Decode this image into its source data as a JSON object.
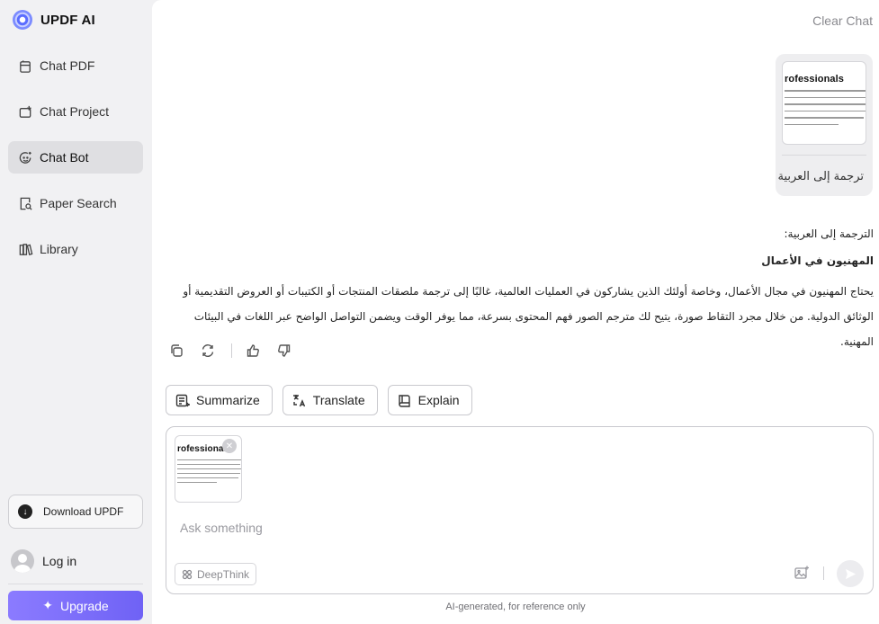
{
  "brand": {
    "name": "UPDF AI"
  },
  "sidebar": {
    "items": [
      {
        "label": "Chat PDF",
        "icon": "chat-pdf-icon",
        "active": false
      },
      {
        "label": "Chat Project",
        "icon": "chat-project-icon",
        "active": false
      },
      {
        "label": "Chat Bot",
        "icon": "chat-bot-icon",
        "active": true
      },
      {
        "label": "Paper Search",
        "icon": "paper-search-icon",
        "active": false
      },
      {
        "label": "Library",
        "icon": "library-icon",
        "active": false
      }
    ],
    "download_label": "Download UPDF",
    "login_label": "Log in",
    "upgrade_label": "Upgrade"
  },
  "header": {
    "clear_chat": "Clear Chat"
  },
  "user_message": {
    "attachment_title": "rofessionals",
    "text": "ترجمة إلى العربية"
  },
  "answer": {
    "intro": "الترجمة إلى العربية:",
    "heading": "المهنيون في الأعمال",
    "body": "يحتاج المهنيون في مجال الأعمال، وخاصة أولئك الذين يشاركون في العمليات العالمية، غالبًا إلى ترجمة ملصقات المنتجات أو الكتيبات أو العروض التقديمية أو الوثائق الدولية. من خلال مجرد التقاط صورة، يتيح لك مترجم الصور فهم المحتوى بسرعة، مما يوفر الوقت ويضمن التواصل الواضح عبر اللغات في البيئات المهنية."
  },
  "quick_actions": {
    "summarize": "Summarize",
    "translate": "Translate",
    "explain": "Explain"
  },
  "composer": {
    "attachment_title": "rofessionals",
    "placeholder": "Ask something",
    "deepthink_label": "DeepThink"
  },
  "footnote": "AI-generated, for reference only",
  "colors": {
    "accent": "#7b6cfb",
    "sidebar_bg": "#f1f1f3",
    "active_item_bg": "#dfdfe2"
  }
}
